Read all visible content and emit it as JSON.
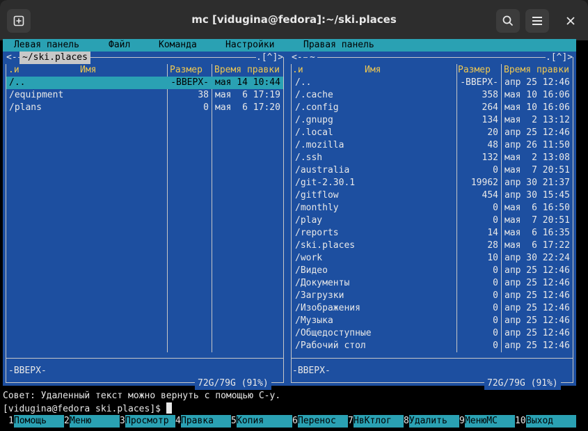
{
  "window": {
    "title": "mc [vidugina@fedora]:~/ski.places"
  },
  "titlebar_icons": {
    "new_tab": "new-tab-icon",
    "search": "search-icon",
    "menu": "hamburger-menu-icon",
    "close": "close-icon"
  },
  "menubar": [
    "Левая панель",
    "Файл",
    "Команда",
    "Настройки",
    "Правая панель"
  ],
  "left_panel": {
    "path": "~/ski.places",
    "corner": ".[^]>",
    "corner_left": "<-",
    "headers": {
      "sort": ".и",
      "name": "Имя",
      "size": "Размер",
      "mtime": "Время правки"
    },
    "rows": [
      {
        "name": "/..",
        "size": "-ВВЕРХ-",
        "mtime": "мая 14 10:44",
        "selected": true
      },
      {
        "name": "/equipment",
        "size": "38",
        "mtime": "мая  6 17:19",
        "selected": false
      },
      {
        "name": "/plans",
        "size": "0",
        "mtime": "мая  6 17:20",
        "selected": false
      }
    ],
    "status": "-ВВЕРХ-",
    "free": "72G/79G (91%)"
  },
  "right_panel": {
    "path": "~",
    "corner": ".[^]>",
    "corner_left": "<-",
    "headers": {
      "sort": ".и",
      "name": "Имя",
      "size": "Размер",
      "mtime": "Время правки"
    },
    "rows": [
      {
        "name": "/..",
        "size": "-ВВЕРХ-",
        "mtime": "апр 25 12:46"
      },
      {
        "name": "/.cache",
        "size": "358",
        "mtime": "мая 10 16:06"
      },
      {
        "name": "/.config",
        "size": "264",
        "mtime": "мая 10 16:06"
      },
      {
        "name": "/.gnupg",
        "size": "134",
        "mtime": "мая  2 13:12"
      },
      {
        "name": "/.local",
        "size": "20",
        "mtime": "апр 25 12:46"
      },
      {
        "name": "/.mozilla",
        "size": "48",
        "mtime": "апр 26 11:50"
      },
      {
        "name": "/.ssh",
        "size": "132",
        "mtime": "мая  2 13:08"
      },
      {
        "name": "/australia",
        "size": "0",
        "mtime": "мая  7 20:51"
      },
      {
        "name": "/git-2.30.1",
        "size": "19962",
        "mtime": "апр 30 21:37"
      },
      {
        "name": "/gitflow",
        "size": "454",
        "mtime": "апр 30 15:45"
      },
      {
        "name": "/monthly",
        "size": "0",
        "mtime": "мая  6 16:50"
      },
      {
        "name": "/play",
        "size": "0",
        "mtime": "мая  7 20:51"
      },
      {
        "name": "/reports",
        "size": "14",
        "mtime": "мая  6 16:35"
      },
      {
        "name": "/ski.places",
        "size": "28",
        "mtime": "мая  6 17:22"
      },
      {
        "name": "/work",
        "size": "10",
        "mtime": "апр 30 22:24"
      },
      {
        "name": "/Видео",
        "size": "0",
        "mtime": "апр 25 12:46"
      },
      {
        "name": "/Документы",
        "size": "0",
        "mtime": "апр 25 12:46"
      },
      {
        "name": "/Загрузки",
        "size": "0",
        "mtime": "апр 25 12:46"
      },
      {
        "name": "/Изображения",
        "size": "0",
        "mtime": "апр 25 12:46"
      },
      {
        "name": "/Музыка",
        "size": "0",
        "mtime": "апр 25 12:46"
      },
      {
        "name": "/Общедоступные",
        "size": "0",
        "mtime": "апр 25 12:46"
      },
      {
        "name": "/Рабочий стол",
        "size": "0",
        "mtime": "апр 25 12:46"
      }
    ],
    "status": "-ВВЕРХ-",
    "free": "72G/79G (91%)"
  },
  "hint": "Совет: Удаленный текст можно вернуть с помощью C-y.",
  "prompt": "[vidugina@fedora ski.places]$ ",
  "fkeys": [
    {
      "num": "1",
      "label": "Помощь"
    },
    {
      "num": "2",
      "label": "Меню"
    },
    {
      "num": "3",
      "label": "Просмотр"
    },
    {
      "num": "4",
      "label": "Правка"
    },
    {
      "num": "5",
      "label": "Копия"
    },
    {
      "num": "6",
      "label": "Перенос"
    },
    {
      "num": "7",
      "label": "НвКтлог"
    },
    {
      "num": "8",
      "label": "Удалить"
    },
    {
      "num": "9",
      "label": "МенюMC"
    },
    {
      "num": "10",
      "label": "Выход"
    }
  ]
}
